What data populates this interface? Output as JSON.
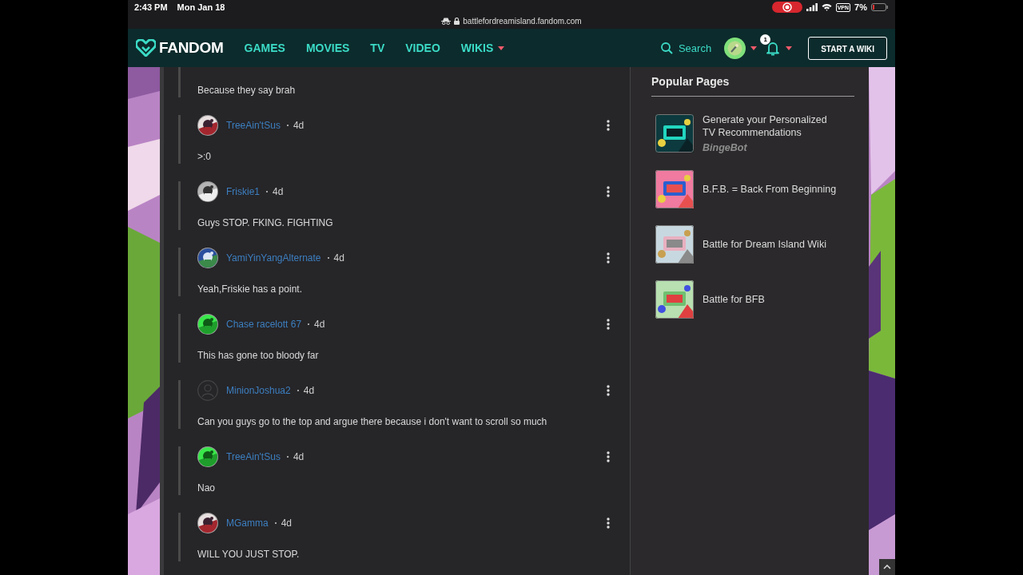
{
  "status_bar": {
    "time": "2:43 PM",
    "date": "Mon Jan 18",
    "vpn": "VPN",
    "battery": "7%"
  },
  "address_bar": {
    "url": "battlefordreamisland.fandom.com"
  },
  "nav": {
    "logo": "FANDOM",
    "links": [
      {
        "label": "GAMES",
        "dropdown": false
      },
      {
        "label": "MOVIES",
        "dropdown": false
      },
      {
        "label": "TV",
        "dropdown": false
      },
      {
        "label": "VIDEO",
        "dropdown": false
      },
      {
        "label": "WIKIS",
        "dropdown": true
      }
    ],
    "search": "Search",
    "notification_count": "1",
    "cta": "START A WIKI"
  },
  "comments": [
    {
      "kind": "continuation",
      "text": "Because they say brah"
    },
    {
      "kind": "picture",
      "author": "TreeAin'tSus",
      "time": "4d",
      "text": ">:0"
    },
    {
      "kind": "picture",
      "author": "Friskie1",
      "time": "4d",
      "text": "Guys STOP. FKING. FIGHTING"
    },
    {
      "kind": "picture",
      "author": "YamiYinYangAlternate",
      "time": "4d",
      "text": "Yeah,Friskie has a point."
    },
    {
      "kind": "picture",
      "author": "Chase racelott 67",
      "time": "4d",
      "text": "This has gone too bloody far"
    },
    {
      "kind": "default",
      "author": "MinionJoshua2",
      "time": "4d",
      "text": "Can you guys go to the top and argue there because i don't want to scroll so much"
    },
    {
      "kind": "picture",
      "author": "TreeAin'tSus",
      "time": "4d",
      "text": "Nao"
    },
    {
      "kind": "picture",
      "author": "MGamma",
      "time": "4d",
      "text": "WILL YOU JUST STOP."
    }
  ],
  "popular_pages": {
    "title": "Popular Pages",
    "items": [
      {
        "title": "Generate your Personalized TV Recommendations",
        "source": "BingeBot"
      },
      {
        "title": "B.F.B. = Back From Beginning"
      },
      {
        "title": "Battle for Dream Island Wiki"
      },
      {
        "title": "Battle for BFB"
      }
    ]
  }
}
